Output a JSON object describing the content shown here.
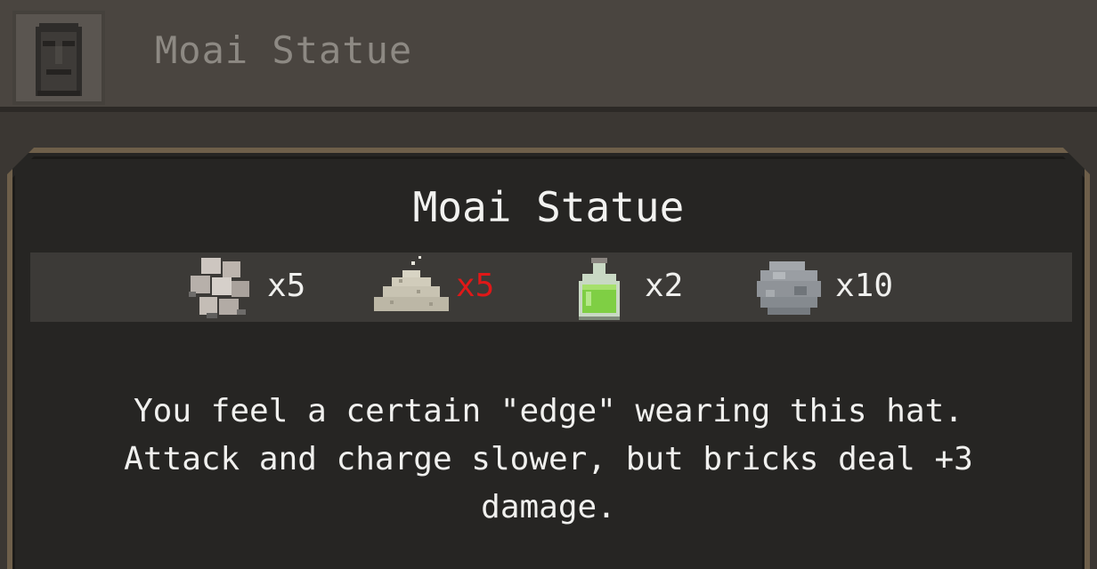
{
  "recipe": {
    "title": "Moai Statue",
    "icon": "moai-head-icon"
  },
  "tooltip": {
    "title": "Moai Statue",
    "ingredients": [
      {
        "icon": "stone-rubble-icon",
        "quantity": "x5",
        "insufficient": false
      },
      {
        "icon": "sand-pile-icon",
        "quantity": "x5",
        "insufficient": true
      },
      {
        "icon": "green-potion-icon",
        "quantity": "x2",
        "insufficient": false
      },
      {
        "icon": "boulder-icon",
        "quantity": "x10",
        "insufficient": false
      }
    ],
    "description_lines": [
      "You feel a certain \"edge\" wearing this hat.",
      "Attack and charge slower, but bricks deal +3",
      "damage."
    ]
  },
  "colors": {
    "insufficient": "#e01818",
    "border": "#6e5f4a"
  }
}
